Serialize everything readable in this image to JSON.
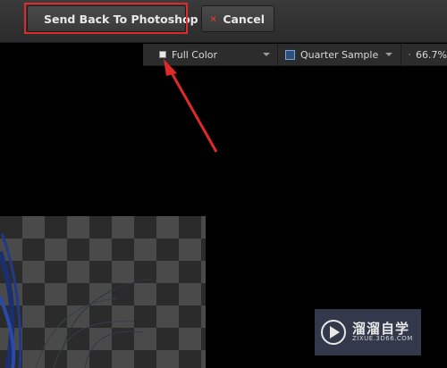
{
  "toolbar": {
    "send_back_label": "Send Back To Photoshop",
    "cancel_label": "Cancel"
  },
  "view_options": {
    "color_mode": "Full Color",
    "sample_mode": "Quarter Sample",
    "zoom": "66.7%"
  },
  "watermark": {
    "title": "溜溜自学",
    "url": "ZIXUE.3D66.COM"
  },
  "colors": {
    "highlight": "#e02a2a",
    "send_icon": "#5cc23a",
    "cancel_icon": "#d93535"
  }
}
